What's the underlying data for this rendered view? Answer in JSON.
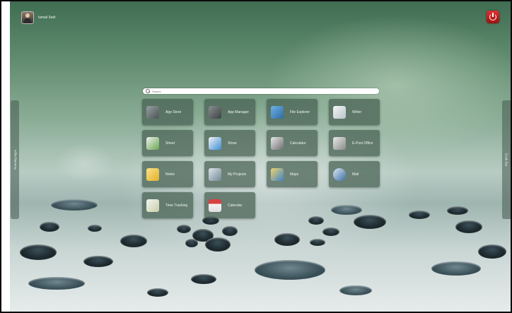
{
  "user": {
    "name": "Ismail Sedi"
  },
  "search": {
    "placeholder": "Search"
  },
  "side_tabs": {
    "left": "Running Apps",
    "right": "Dock Bar"
  },
  "apps": [
    {
      "label": "App Store",
      "icon": "app-store-icon"
    },
    {
      "label": "App Manager",
      "icon": "app-manager-icon"
    },
    {
      "label": "File Explorer",
      "icon": "file-explorer-icon"
    },
    {
      "label": "Writer",
      "icon": "writer-icon"
    },
    {
      "label": "Sheet",
      "icon": "sheet-icon"
    },
    {
      "label": "Show",
      "icon": "show-icon"
    },
    {
      "label": "Calculator",
      "icon": "calculator-icon"
    },
    {
      "label": "E-Post Office",
      "icon": "e-post-office-icon"
    },
    {
      "label": "Notes",
      "icon": "notes-icon"
    },
    {
      "label": "My Projects",
      "icon": "my-projects-icon"
    },
    {
      "label": "Maps",
      "icon": "maps-icon"
    },
    {
      "label": "Mail",
      "icon": "mail-icon"
    },
    {
      "label": "Time Tracking",
      "icon": "time-tracking-icon"
    },
    {
      "label": "Calendar",
      "icon": "calendar-icon"
    }
  ],
  "colors": {
    "power_button": "#c81e1e",
    "tile_bg": "#465f52"
  }
}
